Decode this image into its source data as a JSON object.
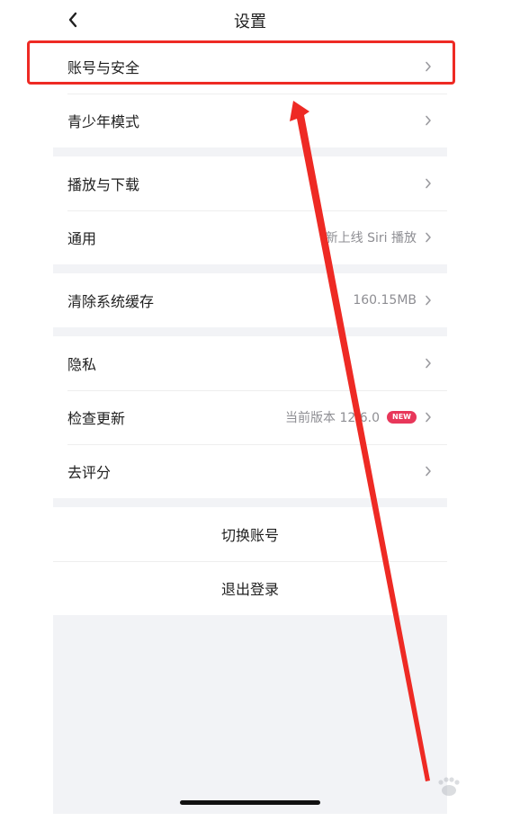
{
  "header": {
    "title": "设置"
  },
  "groups": [
    {
      "items": [
        {
          "label": "账号与安全",
          "value": ""
        },
        {
          "label": "青少年模式",
          "value": ""
        }
      ]
    },
    {
      "items": [
        {
          "label": "播放与下载",
          "value": ""
        },
        {
          "label": "通用",
          "value": "新上线 Siri 播放"
        }
      ]
    },
    {
      "items": [
        {
          "label": "清除系统缓存",
          "value": "160.15MB"
        }
      ]
    },
    {
      "items": [
        {
          "label": "隐私",
          "value": ""
        },
        {
          "label": "检查更新",
          "value": "当前版本 12.6.0",
          "badge": "NEW"
        },
        {
          "label": "去评分",
          "value": ""
        }
      ]
    }
  ],
  "actions": {
    "switch_account": "切换账号",
    "logout": "退出登录"
  },
  "colors": {
    "annotation_red": "#ee2a24",
    "badge_pink": "#e8375a",
    "page_gray": "#f2f3f6"
  },
  "icons": {
    "back": "chevron-left-icon",
    "row_arrow": "chevron-right-icon"
  }
}
